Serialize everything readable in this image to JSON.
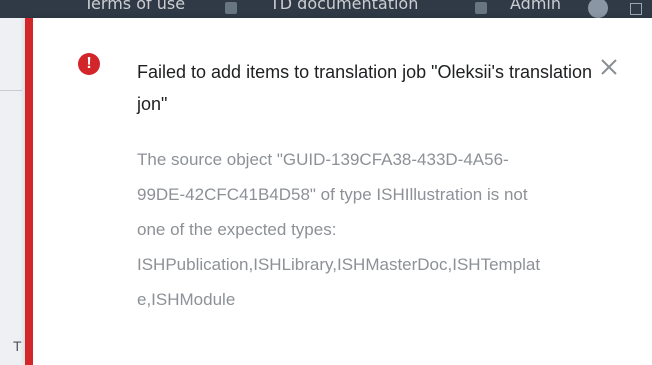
{
  "header": {
    "nav_1": "Terms of use",
    "nav_2": "TD documentation",
    "nav_3": "Admin"
  },
  "page_edge": {
    "char": "T"
  },
  "toast": {
    "title": "Failed to add items to translation job \"Oleksii's translation jon\"",
    "message": "The source object \"GUID-139CFA38-433D-4A56-\n99DE-42CFC41B4D58\" of type ISHIllustration is not\none of the expected types:\nISHPublication,ISHLibrary,ISHMasterDoc,ISHTemplat\ne,ISHModule",
    "alert_icon": "!",
    "colors": {
      "error": "#d2262a",
      "title": "#1d1f21",
      "message": "#8d9196"
    }
  }
}
